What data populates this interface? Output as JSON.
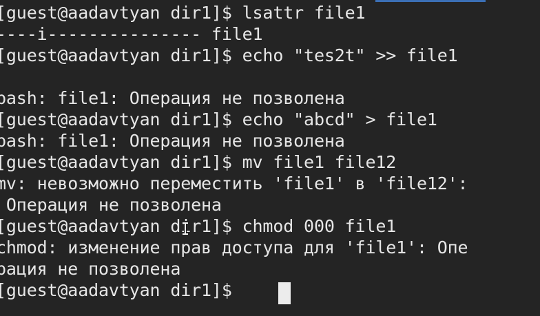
{
  "terminal": {
    "lines": [
      "[guest@aadavtyan dir1]$ lsattr file1",
      "----i--------------- file1",
      "[guest@aadavtyan dir1]$ echo \"tes2t\" >> file1",
      "",
      "bash: file1: Операция не позволена",
      "[guest@aadavtyan dir1]$ echo \"abcd\" > file1",
      "bash: file1: Операция не позволена",
      "[guest@aadavtyan dir1]$ mv file1 file12",
      "mv: невозможно переместить 'file1' в 'file12':",
      " Операция не позволена",
      "[guest@aadavtyan dir1]$ chmod 000 file1",
      "chmod: изменение прав доступа для 'file1': Опе",
      "рация не позволена",
      "[guest@aadavtyan dir1]$ "
    ]
  },
  "colors": {
    "background": "#242424",
    "foreground": "#e6e6e6",
    "accent": "#3b6fb5",
    "cursor": "#ececec"
  }
}
